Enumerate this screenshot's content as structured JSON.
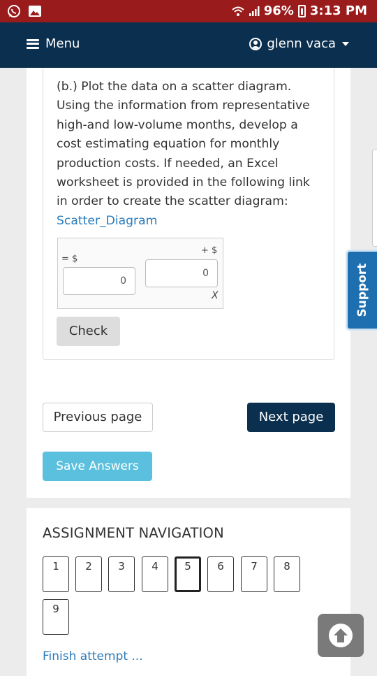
{
  "status_bar": {
    "battery": "96%",
    "time": "3:13 PM"
  },
  "navbar": {
    "menu_label": "Menu",
    "user_name": "glenn vaca"
  },
  "question": {
    "text": "(b.) Plot the data on a scatter diagram. Using the information from representative high-and low-volume months, develop a cost estimating equation for monthly production costs. If needed, an Excel worksheet is provided in the following link in order to create the scatter diagram:",
    "link_text": "Scatter_Diagram",
    "equation": {
      "left_label": "= $",
      "right_label": "+ $",
      "input1_value": "0",
      "input2_value": "0",
      "var_label": "X"
    },
    "check_label": "Check"
  },
  "pager": {
    "prev_label": "Previous page",
    "next_label": "Next page",
    "save_label": "Save Answers"
  },
  "assignment_nav": {
    "title": "ASSIGNMENT NAVIGATION",
    "pages": [
      "1",
      "2",
      "3",
      "4",
      "5",
      "6",
      "7",
      "8",
      "9"
    ],
    "current": "5",
    "finish_label": "Finish attempt ..."
  },
  "support_label": "Support",
  "colors": {
    "navbar": "#0b2f4f",
    "status_bar": "#9a1b1b",
    "link": "#2b7bb9",
    "save": "#5bc0de",
    "support": "#1d6fb0"
  }
}
